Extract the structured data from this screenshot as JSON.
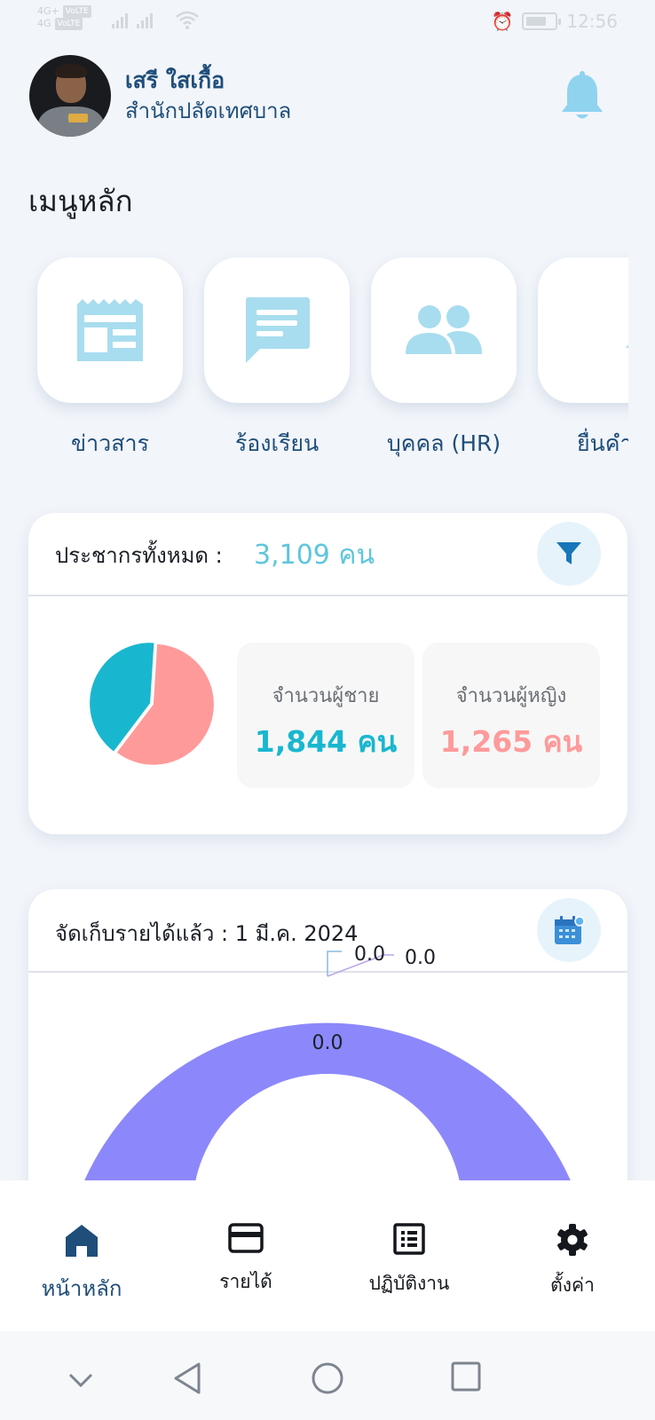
{
  "status_bar": {
    "carrier1": "4G+",
    "carrier2": "4G",
    "time": "12:56"
  },
  "profile": {
    "name": "เสรี ใสเกื้อ",
    "department": "สำนักปลัดเทศบาล",
    "avatar_icon": "user-photo",
    "bell_icon": "bell-icon"
  },
  "main_menu": {
    "title": "เมนูหลัก",
    "items": [
      {
        "label": "ข่าวสาร",
        "icon": "newspaper-icon"
      },
      {
        "label": "ร้องเรียน",
        "icon": "chat-message-icon"
      },
      {
        "label": "บุคคล (HR)",
        "icon": "people-icon"
      },
      {
        "label": "ยื่นคำร้",
        "icon": "alert-bell-icon"
      }
    ]
  },
  "population": {
    "title": "ประชากรทั้งหมด :",
    "total": "3,109 คน",
    "filter_icon": "filter-icon",
    "male_label": "จำนวนผู้ชาย",
    "male_value": "1,844 คน",
    "female_label": "จำนวนผู้หญิง",
    "female_value": "1,265 คน"
  },
  "revenue": {
    "title": "จัดเก็บรายได้แล้ว : 1 มี.ค. 2024",
    "calendar_icon": "calendar-icon",
    "labels": [
      "0.0",
      "0.0",
      "0.0"
    ]
  },
  "bottom_nav": [
    {
      "label": "หน้าหลัก",
      "icon": "home-icon",
      "active": true
    },
    {
      "label": "รายได้",
      "icon": "credit-card-icon",
      "active": false
    },
    {
      "label": "ปฏิบัติงาน",
      "icon": "list-icon",
      "active": false
    },
    {
      "label": "ตั้งค่า",
      "icon": "gear-icon",
      "active": false
    }
  ],
  "colors": {
    "primary": "#1f4e7a",
    "accent_light": "#a8ddef",
    "male": "#19b7cf",
    "female": "#ff9a9a",
    "donut": "#8c88fb"
  },
  "chart_data": {
    "type": "pie",
    "categories": [
      "ชาย",
      "หญิง"
    ],
    "values": [
      1844,
      1265
    ],
    "colors": [
      "#ff9a9a",
      "#19b7cf"
    ]
  }
}
